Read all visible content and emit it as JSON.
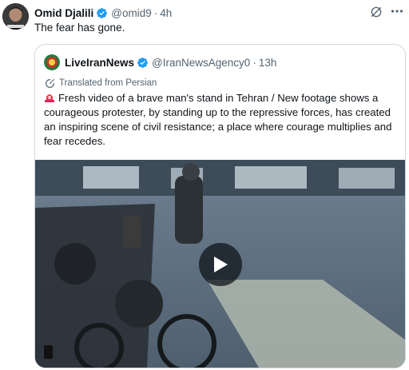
{
  "tweet": {
    "author_name": "Omid Djalili",
    "handle": "@omid9",
    "separator": "·",
    "time": "4h",
    "text": "The fear has gone.",
    "avatar_icon": "avatar-photo-icon"
  },
  "quote": {
    "author_name": "LiveIranNews",
    "handle": "@IranNewsAgency0",
    "separator": "·",
    "time": "13h",
    "translated_label": "Translated from Persian",
    "body": "Fresh video of a brave man's stand in Tehran / New footage shows a courageous protester, by standing up to the repressive forces, has created an inspiring scene of civil resistance; a place where courage multiplies and fear recedes.",
    "emoji_icon": "siren-icon"
  },
  "icons": {
    "verified": "verified-badge-icon",
    "grok": "grok-icon",
    "more": "more-icon",
    "translate": "translate-icon",
    "play": "play-icon"
  },
  "colors": {
    "verified_blue": "#1d9bf0",
    "secondary_text": "#536471",
    "border": "#cfd9de",
    "primary_text": "#0f1419"
  }
}
